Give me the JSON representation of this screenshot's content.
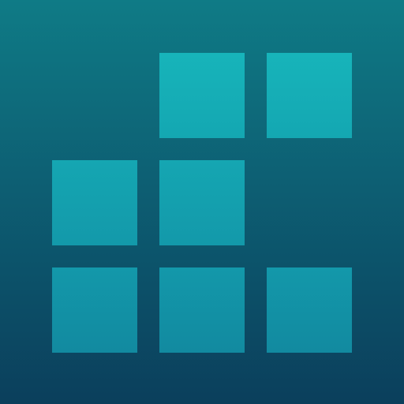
{
  "icon": {
    "name": "grid-blocks-app-icon",
    "colors": {
      "background_top": "#0f7b86",
      "background_bottom": "#0b3f5c",
      "tile_top": "#17b4ba",
      "tile_bottom": "#128aa0"
    },
    "grid": {
      "rows": 3,
      "columns": 3,
      "filled": [
        [
          false,
          true,
          true
        ],
        [
          true,
          true,
          false
        ],
        [
          true,
          true,
          true
        ]
      ]
    }
  }
}
